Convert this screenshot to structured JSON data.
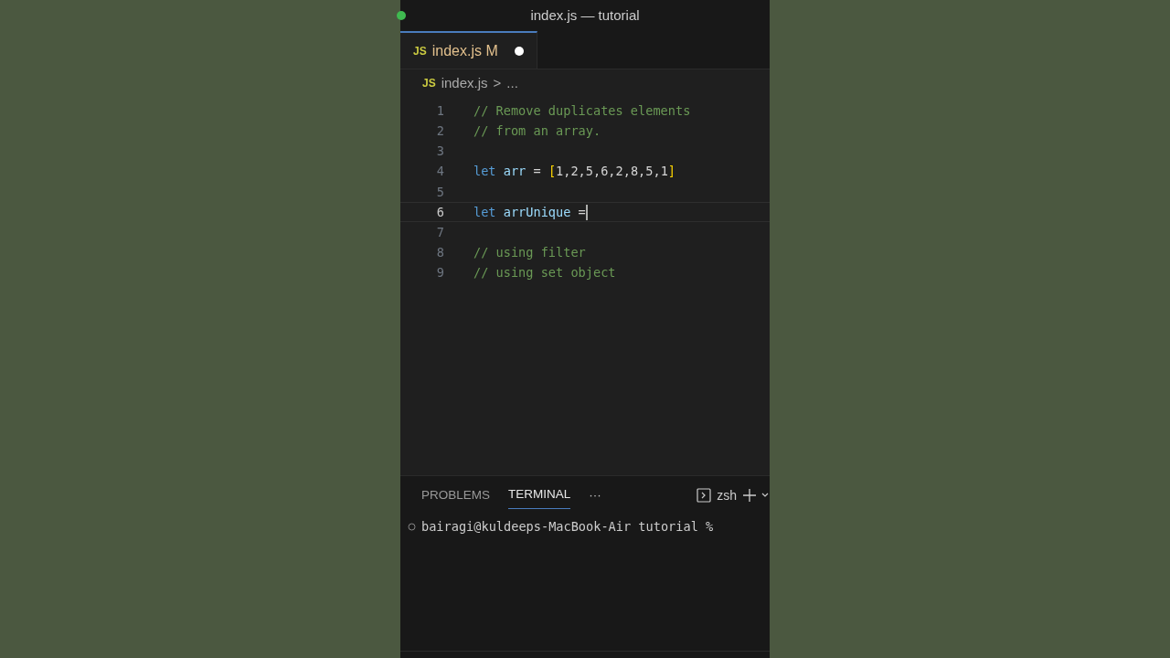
{
  "window": {
    "title": "index.js — tutorial"
  },
  "tabs": [
    {
      "icon": "JS",
      "label": "index.js",
      "badge": "M",
      "modified": true,
      "selected": true
    }
  ],
  "breadcrumb": {
    "icon": "JS",
    "file": "index.js",
    "separator": ">",
    "rest": "..."
  },
  "editor": {
    "lines": [
      {
        "number": "1",
        "current": false,
        "tokens": [
          {
            "kind": "comment",
            "text": "// Remove duplicates elements"
          }
        ]
      },
      {
        "number": "2",
        "current": false,
        "tokens": [
          {
            "kind": "comment",
            "text": "// from an array."
          }
        ]
      },
      {
        "number": "3",
        "current": false
      },
      {
        "number": "4",
        "current": false,
        "tokens": [
          {
            "kind": "keyword",
            "text": "let "
          },
          {
            "kind": "variable",
            "text": "arr"
          },
          {
            "kind": "plain",
            "text": " = "
          },
          {
            "kind": "bracket",
            "text": "["
          },
          {
            "kind": "plain",
            "text": "1,2,5,6,2,8,5,1"
          },
          {
            "kind": "bracket",
            "text": "]"
          }
        ]
      },
      {
        "number": "5",
        "current": false
      },
      {
        "number": "6",
        "current": true,
        "tokens": [
          {
            "kind": "keyword",
            "text": "let "
          },
          {
            "kind": "variable",
            "text": "arrUnique"
          },
          {
            "kind": "plain",
            "text": " ="
          }
        ]
      },
      {
        "number": "7",
        "current": false
      },
      {
        "number": "8",
        "current": false,
        "tokens": [
          {
            "kind": "comment",
            "text": "// using filter"
          }
        ]
      },
      {
        "number": "9",
        "current": false,
        "tokens": [
          {
            "kind": "comment",
            "text": "// using set object"
          }
        ]
      }
    ]
  },
  "panel": {
    "tabs": [
      {
        "label": "PROBLEMS",
        "selected": false
      },
      {
        "label": "TERMINAL",
        "selected": true
      }
    ],
    "more": "···",
    "shell": "zsh",
    "terminal": {
      "prompt": "bairagi@kuldeeps-MacBook-Air tutorial %"
    }
  }
}
